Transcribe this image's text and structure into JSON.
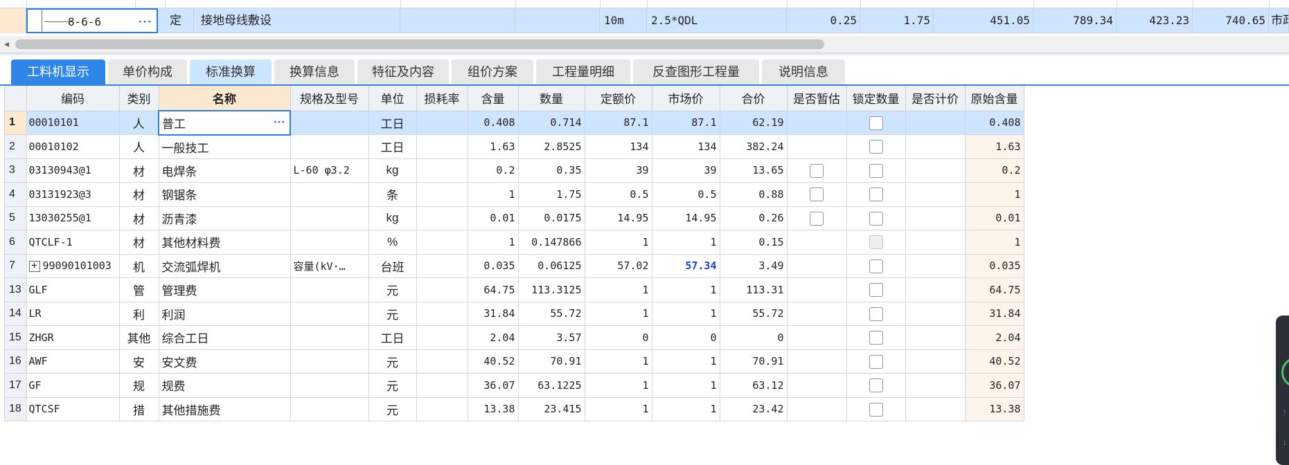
{
  "top_row": {
    "code": "8-6-6",
    "type": "定",
    "name": "接地母线敷设",
    "unit": "10m",
    "spec": "2.5*QDL",
    "v1": "0.25",
    "v2": "1.75",
    "v3": "451.05",
    "v4": "789.34",
    "v5": "423.23",
    "v6": "740.65",
    "v7": "市政"
  },
  "tabs": [
    {
      "label": "工料机显示"
    },
    {
      "label": "单价构成"
    },
    {
      "label": "标准换算"
    },
    {
      "label": "换算信息"
    },
    {
      "label": "特征及内容"
    },
    {
      "label": "组价方案"
    },
    {
      "label": "工程量明细"
    },
    {
      "label": "反查图形工程量"
    },
    {
      "label": "说明信息"
    }
  ],
  "columns": [
    "编码",
    "类别",
    "名称",
    "规格及型号",
    "单位",
    "损耗率",
    "含量",
    "数量",
    "定额价",
    "市场价",
    "合价",
    "是否暂估",
    "锁定数量",
    "是否计价",
    "原始含量"
  ],
  "rows": [
    {
      "no": "1",
      "code": "00010101",
      "cat": "人",
      "name": "普工",
      "spec": "",
      "unit": "工日",
      "loss": "",
      "qty_per": "0.408",
      "qty": "0.714",
      "quota": "87.1",
      "market": "87.1",
      "total": "62.19",
      "est": "",
      "lock": "box",
      "priced": "",
      "orig": "0.408"
    },
    {
      "no": "2",
      "code": "00010102",
      "cat": "人",
      "name": "一般技工",
      "spec": "",
      "unit": "工日",
      "loss": "",
      "qty_per": "1.63",
      "qty": "2.8525",
      "quota": "134",
      "market": "134",
      "total": "382.24",
      "est": "",
      "lock": "box",
      "priced": "",
      "orig": "1.63"
    },
    {
      "no": "3",
      "code": "03130943@1",
      "cat": "材",
      "name": "电焊条",
      "spec": "L-60 φ3.2",
      "unit": "kg",
      "loss": "",
      "qty_per": "0.2",
      "qty": "0.35",
      "quota": "39",
      "market": "39",
      "total": "13.65",
      "est": "box",
      "lock": "box",
      "priced": "",
      "orig": "0.2"
    },
    {
      "no": "4",
      "code": "03131923@3",
      "cat": "材",
      "name": "钢锯条",
      "spec": "",
      "unit": "条",
      "loss": "",
      "qty_per": "1",
      "qty": "1.75",
      "quota": "0.5",
      "market": "0.5",
      "total": "0.88",
      "est": "box",
      "lock": "box",
      "priced": "",
      "orig": "1"
    },
    {
      "no": "5",
      "code": "13030255@1",
      "cat": "材",
      "name": "沥青漆",
      "spec": "",
      "unit": "kg",
      "loss": "",
      "qty_per": "0.01",
      "qty": "0.0175",
      "quota": "14.95",
      "market": "14.95",
      "total": "0.26",
      "est": "box",
      "lock": "box",
      "priced": "",
      "orig": "0.01"
    },
    {
      "no": "6",
      "code": "QTCLF-1",
      "cat": "材",
      "name": "其他材料费",
      "spec": "",
      "unit": "%",
      "loss": "",
      "qty_per": "1",
      "qty": "0.147866",
      "quota": "1",
      "market": "1",
      "total": "0.15",
      "est": "",
      "lock": "disabled",
      "priced": "",
      "orig": "1"
    },
    {
      "no": "7",
      "code": "99090101003",
      "cat": "机",
      "name": "交流弧焊机",
      "spec": "容量(kV·…",
      "unit": "台班",
      "loss": "",
      "qty_per": "0.035",
      "qty": "0.06125",
      "quota": "57.02",
      "market": "57.34",
      "total": "3.49",
      "est": "",
      "lock": "box",
      "priced": "",
      "orig": "0.035"
    },
    {
      "no": "13",
      "code": "GLF",
      "cat": "管",
      "name": "管理费",
      "spec": "",
      "unit": "元",
      "loss": "",
      "qty_per": "64.75",
      "qty": "113.3125",
      "quota": "1",
      "market": "1",
      "total": "113.31",
      "est": "",
      "lock": "box",
      "priced": "",
      "orig": "64.75"
    },
    {
      "no": "14",
      "code": "LR",
      "cat": "利",
      "name": "利润",
      "spec": "",
      "unit": "元",
      "loss": "",
      "qty_per": "31.84",
      "qty": "55.72",
      "quota": "1",
      "market": "1",
      "total": "55.72",
      "est": "",
      "lock": "box",
      "priced": "",
      "orig": "31.84"
    },
    {
      "no": "15",
      "code": "ZHGR",
      "cat": "其他",
      "name": "综合工日",
      "spec": "",
      "unit": "工日",
      "loss": "",
      "qty_per": "2.04",
      "qty": "3.57",
      "quota": "0",
      "market": "0",
      "total": "0",
      "est": "",
      "lock": "box",
      "priced": "",
      "orig": "2.04"
    },
    {
      "no": "16",
      "code": "AWF",
      "cat": "安",
      "name": "安文费",
      "spec": "",
      "unit": "元",
      "loss": "",
      "qty_per": "40.52",
      "qty": "70.91",
      "quota": "1",
      "market": "1",
      "total": "70.91",
      "est": "",
      "lock": "box",
      "priced": "",
      "orig": "40.52"
    },
    {
      "no": "17",
      "code": "GF",
      "cat": "规",
      "name": "规费",
      "spec": "",
      "unit": "元",
      "loss": "",
      "qty_per": "36.07",
      "qty": "63.1225",
      "quota": "1",
      "market": "1",
      "total": "63.12",
      "est": "",
      "lock": "box",
      "priced": "",
      "orig": "36.07"
    },
    {
      "no": "18",
      "code": "QTCSF",
      "cat": "措",
      "name": "其他措施费",
      "spec": "",
      "unit": "元",
      "loss": "",
      "qty_per": "13.38",
      "qty": "23.415",
      "quota": "1",
      "market": "1",
      "total": "23.42",
      "est": "",
      "lock": "box",
      "priced": "",
      "orig": "13.38"
    }
  ],
  "colors": {
    "accent": "#2f86e8",
    "selected_row": "#cfe4ff",
    "header_highlight": "#fde9cf",
    "market_changed": "#1c3ee8"
  },
  "icons": {
    "expand": "plus-square-icon",
    "more": "ellipsis-icon",
    "scroll_left": "arrow-left-icon"
  }
}
